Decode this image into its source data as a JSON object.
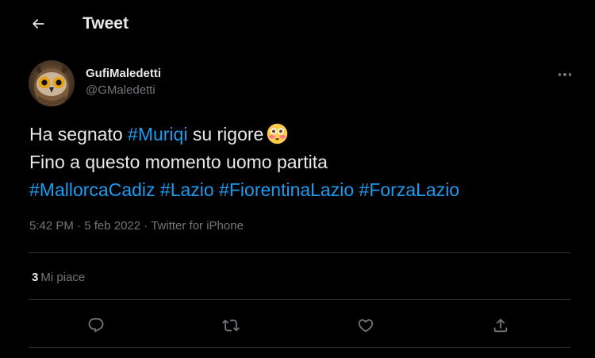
{
  "header": {
    "back_icon": "arrow-left-icon",
    "title": "Tweet"
  },
  "tweet": {
    "author": {
      "display_name": "GufiMaledetti",
      "handle": "@GMaledetti",
      "avatar": "owl-avatar"
    },
    "more_icon": "more-horizontal-icon",
    "text": {
      "line1_prefix": "Ha segnato ",
      "line1_hashtag": "#Muriqi",
      "line1_suffix": " su rigore",
      "line1_emoji": "flushed-face-emoji",
      "line2": "Fino a questo momento uomo partita",
      "hashtags_line3": [
        "#MallorcaCadiz",
        "#Lazio",
        "#FiorentinaLazio",
        "#ForzaLazio"
      ]
    },
    "meta": {
      "time": "5:42 PM",
      "separator": "·",
      "date": "5 feb 2022",
      "source": "Twitter for iPhone"
    },
    "likes": {
      "count": "3",
      "label": "Mi piace"
    },
    "actions": {
      "reply_icon": "reply-icon",
      "retweet_icon": "retweet-icon",
      "like_icon": "heart-icon",
      "share_icon": "share-icon"
    }
  },
  "colors": {
    "background": "#000000",
    "text_primary": "#e7e9ea",
    "text_secondary": "#71767b",
    "link": "#1d9bf0",
    "divider": "#2f3336"
  }
}
